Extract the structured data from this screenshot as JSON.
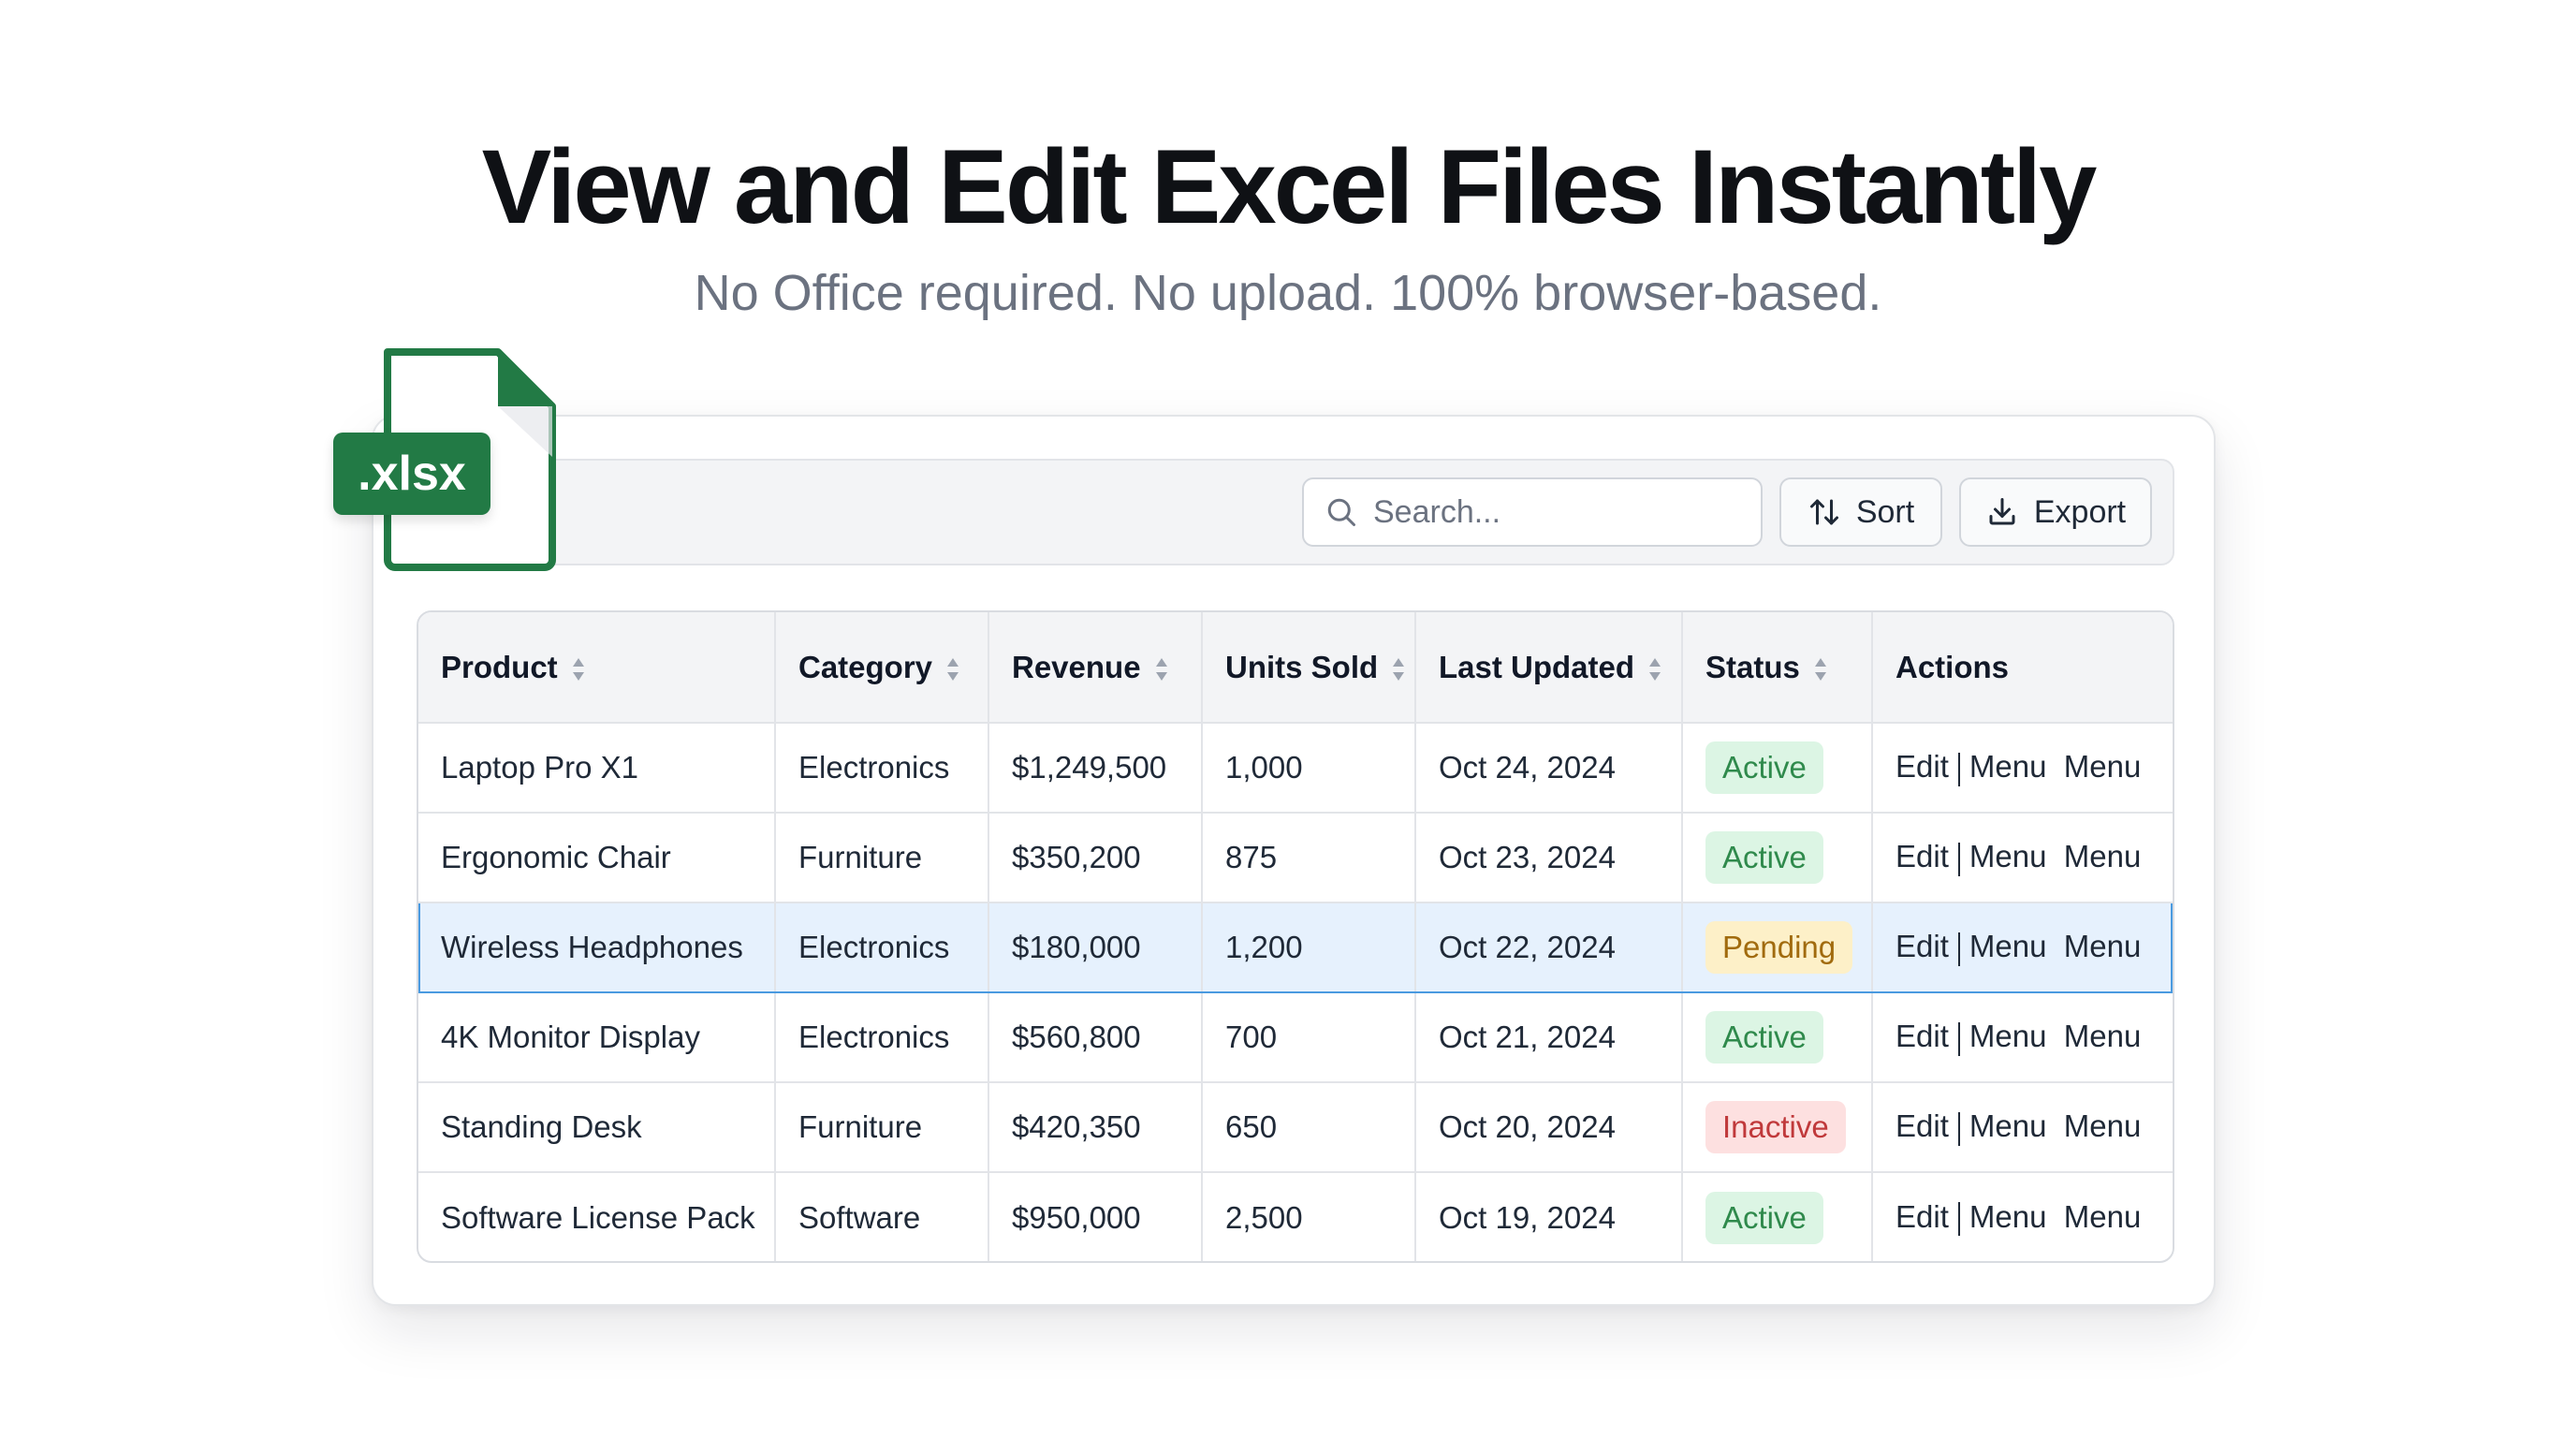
{
  "hero": {
    "title": "View and Edit Excel Files Instantly",
    "subtitle": "No Office required. No upload. 100% browser-based."
  },
  "file_badge": {
    "label": ".xlsx",
    "color": "#227a45"
  },
  "toolbar": {
    "search_placeholder": "Search...",
    "sort_label": "Sort",
    "export_label": "Export"
  },
  "table": {
    "columns": [
      "Product",
      "Category",
      "Revenue",
      "Units Sold",
      "Last Updated",
      "Status",
      "Actions"
    ],
    "rows": [
      {
        "product": "Laptop Pro X1",
        "category": "Electronics",
        "revenue": "$1,249,500",
        "units": "1,000",
        "updated": "Oct 24, 2024",
        "status": "Active",
        "status_kind": "active"
      },
      {
        "product": "Ergonomic Chair",
        "category": "Furniture",
        "revenue": "$350,200",
        "units": "875",
        "updated": "Oct 23, 2024",
        "status": "Active",
        "status_kind": "active"
      },
      {
        "product": "Wireless Headphones",
        "category": "Electronics",
        "revenue": "$180,000",
        "units": "1,200",
        "updated": "Oct 22, 2024",
        "status": "Pending",
        "status_kind": "pending",
        "selected": true
      },
      {
        "product": "4K Monitor Display",
        "category": "Electronics",
        "revenue": "$560,800",
        "units": "700",
        "updated": "Oct 21, 2024",
        "status": "Active",
        "status_kind": "active"
      },
      {
        "product": "Standing Desk",
        "category": "Furniture",
        "revenue": "$420,350",
        "units": "650",
        "updated": "Oct 20, 2024",
        "status": "Inactive",
        "status_kind": "inactive"
      },
      {
        "product": "Software License Pack",
        "category": "Software",
        "revenue": "$950,000",
        "units": "2,500",
        "updated": "Oct 19, 2024",
        "status": "Active",
        "status_kind": "active"
      }
    ],
    "action_labels": {
      "edit": "Edit",
      "menu": "Menu",
      "menu_secondary": "Menu"
    }
  },
  "colors": {
    "status_active": "#2f8a4c",
    "status_pending": "#a16b0e",
    "status_inactive": "#c0393b",
    "selection": "#4a9ae0"
  },
  "icons": [
    "xlsx-file-icon",
    "search-icon",
    "sort-icon",
    "download-icon",
    "sort-arrows-icon"
  ]
}
